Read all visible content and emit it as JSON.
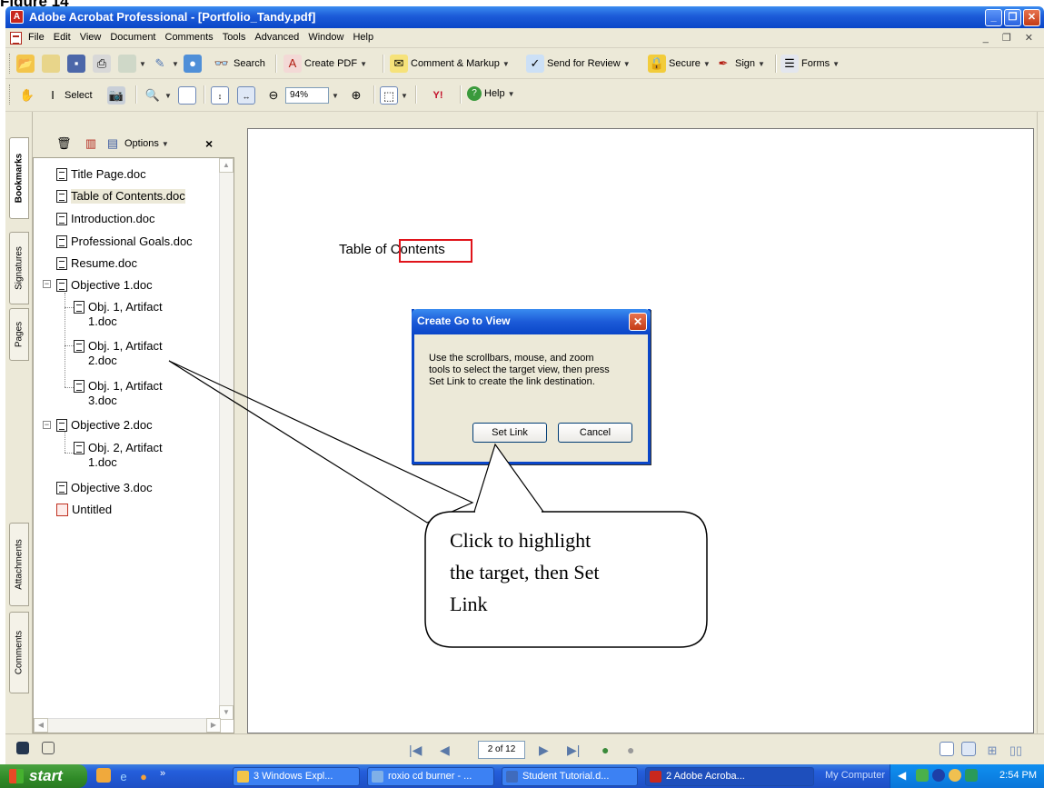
{
  "figure_label": "Figure 14",
  "window": {
    "title": "Adobe Acrobat Professional - [Portfolio_Tandy.pdf]"
  },
  "menus": [
    "File",
    "Edit",
    "View",
    "Document",
    "Comments",
    "Tools",
    "Advanced",
    "Window",
    "Help"
  ],
  "toolbar1": {
    "search": "Search",
    "create_pdf": "Create PDF",
    "comment_markup": "Comment & Markup",
    "send_review": "Send for Review",
    "secure": "Secure",
    "sign": "Sign",
    "forms": "Forms"
  },
  "toolbar2": {
    "select": "Select",
    "zoom_value": "94%",
    "help": "Help"
  },
  "side_tabs": [
    "Bookmarks",
    "Signatures",
    "Pages",
    "Attachments",
    "Comments"
  ],
  "panel": {
    "options": "Options",
    "close": "×"
  },
  "bookmarks": [
    "Title Page.doc",
    "Table of Contents.doc",
    "Introduction.doc",
    "Professional Goals.doc",
    "Resume.doc",
    "Objective 1.doc",
    [
      "Obj. 1, Artifact",
      "1.doc"
    ],
    [
      "Obj. 1, Artifact",
      "2.doc"
    ],
    [
      "Obj. 1, Artifact",
      "3.doc"
    ],
    "Objective 2.doc",
    [
      "Obj. 2, Artifact",
      "1.doc"
    ],
    "Objective 3.doc",
    "Untitled"
  ],
  "document": {
    "text_before": "Table of ",
    "text_linked": "Contents"
  },
  "dialog": {
    "title": "Create Go to View",
    "message": "Use the scrollbars, mouse, and zoom tools to select the target view, then press Set Link to create the link destination.",
    "set_link": "Set Link",
    "cancel": "Cancel"
  },
  "callout": {
    "lines": [
      "Click to highlight",
      "the target, then Set",
      "Link"
    ]
  },
  "statusbar": {
    "page_indicator": "2 of 12"
  },
  "taskbar": {
    "start": "start",
    "tasks": [
      "3 Windows Expl...",
      "roxio cd burner - ...",
      "Student Tutorial.d...",
      "2 Adobe Acroba..."
    ],
    "my_computer": "My Computer",
    "time": "2:54 PM"
  }
}
